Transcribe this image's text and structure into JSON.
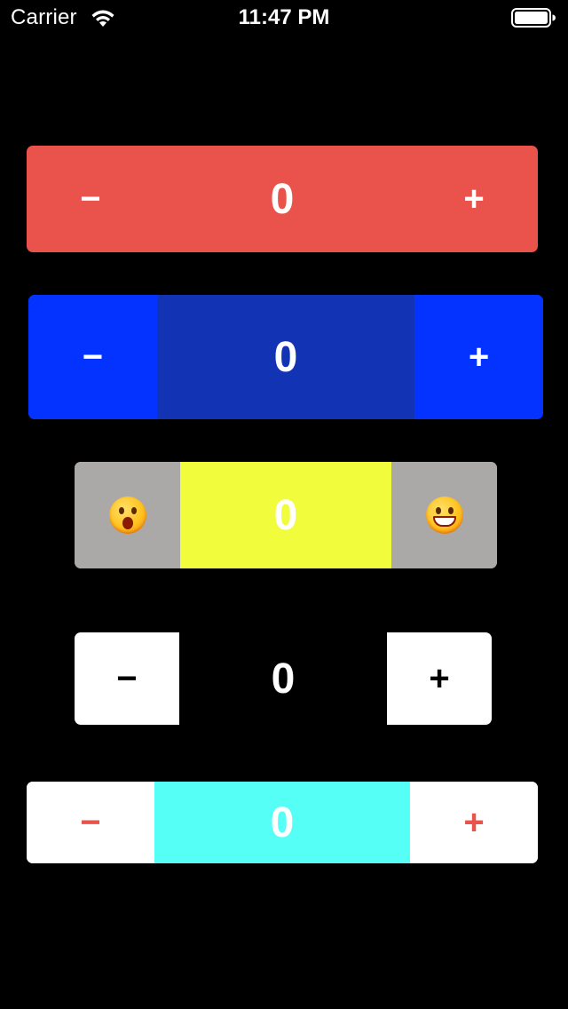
{
  "status_bar": {
    "carrier": "Carrier",
    "time": "11:47 PM",
    "icons": [
      "wifi-icon",
      "battery-icon"
    ]
  },
  "steppers": [
    {
      "minus_label": "−",
      "value": "0",
      "plus_label": "+",
      "style": "red",
      "colors": {
        "background": "#ea534c",
        "text": "#ffffff"
      }
    },
    {
      "minus_label": "−",
      "value": "0",
      "plus_label": "+",
      "style": "blue",
      "colors": {
        "buttons": "#0433ff",
        "value_bg": "#1233b4",
        "text": "#ffffff"
      }
    },
    {
      "minus_icon": "shocked-face-icon",
      "value": "0",
      "plus_icon": "grinning-face-icon",
      "style": "emoji",
      "colors": {
        "buttons": "#aaa9a8",
        "value_bg": "#f0fc3c",
        "text": "#ffffff"
      }
    },
    {
      "minus_label": "−",
      "value": "0",
      "plus_label": "+",
      "style": "white-buttons",
      "colors": {
        "buttons": "#ffffff",
        "button_text": "#000000",
        "value_bg": "#000000",
        "text": "#ffffff"
      }
    },
    {
      "minus_label": "−",
      "value": "0",
      "plus_label": "+",
      "style": "cyan",
      "colors": {
        "buttons": "#ffffff",
        "button_text": "#ea534c",
        "value_bg": "#56fff6",
        "text": "#ffffff"
      }
    }
  ]
}
